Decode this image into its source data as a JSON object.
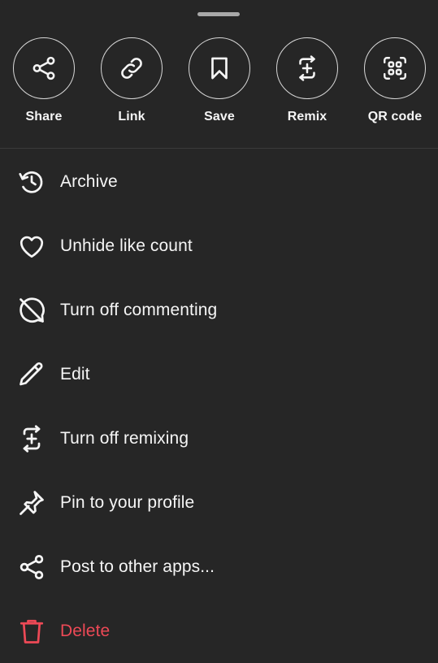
{
  "colors": {
    "background": "#262626",
    "text": "#f5f5f5",
    "danger": "#ed4956",
    "icon": "#f5f5f5"
  },
  "actions": [
    {
      "label": "Share",
      "icon": "share-icon"
    },
    {
      "label": "Link",
      "icon": "link-icon"
    },
    {
      "label": "Save",
      "icon": "bookmark-icon"
    },
    {
      "label": "Remix",
      "icon": "remix-icon"
    },
    {
      "label": "QR code",
      "icon": "qr-code-icon"
    }
  ],
  "menu": [
    {
      "label": "Archive",
      "icon": "archive-icon"
    },
    {
      "label": "Unhide like count",
      "icon": "heart-icon"
    },
    {
      "label": "Turn off commenting",
      "icon": "comment-off-icon"
    },
    {
      "label": "Edit",
      "icon": "pencil-icon"
    },
    {
      "label": "Turn off remixing",
      "icon": "remix-icon"
    },
    {
      "label": "Pin to your profile",
      "icon": "pin-icon"
    },
    {
      "label": "Post to other apps...",
      "icon": "share-icon"
    },
    {
      "label": "Delete",
      "icon": "trash-icon"
    }
  ]
}
